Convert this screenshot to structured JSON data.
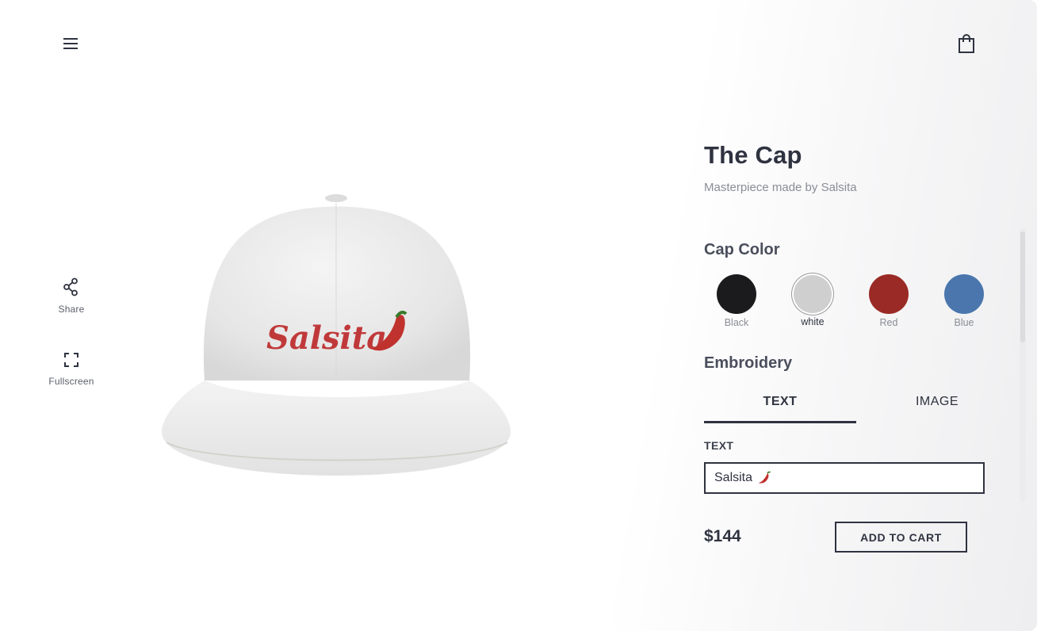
{
  "header": {
    "menu_icon": "hamburger-menu-icon",
    "cart_icon": "shopping-bag-icon"
  },
  "tools": {
    "share_label": "Share",
    "fullscreen_label": "Fullscreen"
  },
  "product": {
    "title": "The Cap",
    "subtitle": "Masterpiece made by Salsita",
    "embroidery_preview": "Salsita"
  },
  "cap_color": {
    "heading": "Cap Color",
    "options": [
      {
        "name": "Black",
        "color": "#1b1b1d",
        "selected": false
      },
      {
        "name": "white",
        "color": "#cfcfcf",
        "selected": true
      },
      {
        "name": "Red",
        "color": "#9a2a25",
        "selected": false
      },
      {
        "name": "Blue",
        "color": "#4a76ad",
        "selected": false
      }
    ]
  },
  "embroidery": {
    "heading": "Embroidery",
    "tabs": [
      {
        "label": "TEXT",
        "active": true
      },
      {
        "label": "IMAGE",
        "active": false
      }
    ],
    "field_label": "TEXT",
    "text_value": "Salsita"
  },
  "purchase": {
    "price": "$144",
    "add_to_cart_label": "ADD TO CART"
  },
  "colors": {
    "ink": "#2f3340",
    "muted": "#8a8d94",
    "embroidery_red": "#c0393a"
  }
}
